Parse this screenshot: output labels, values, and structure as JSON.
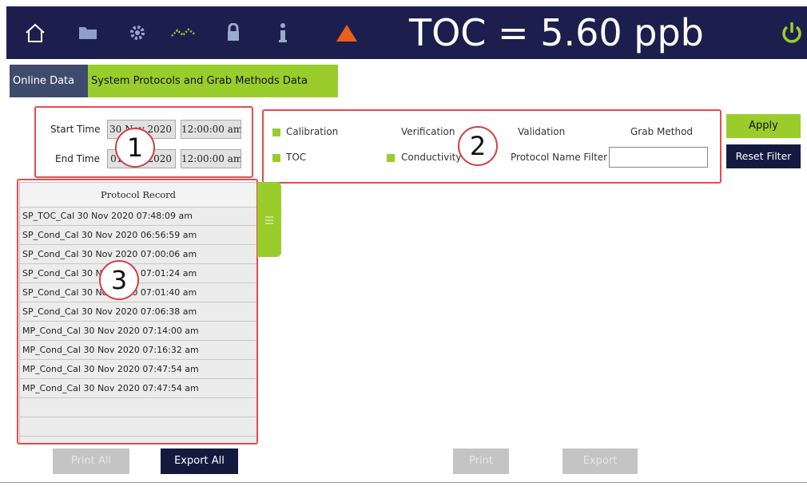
{
  "header": {
    "readout": "TOC = 5.60 ppb",
    "icons": [
      "home-icon",
      "folder-icon",
      "gear-icon",
      "trend-icon",
      "lock-icon",
      "info-icon",
      "warning-icon",
      "power-icon"
    ],
    "colors": {
      "bar": "#1c1f4d",
      "accent": "#9acd2c",
      "alert": "#e8601c"
    }
  },
  "tabs": [
    "Online Data",
    "System Protocols and Grab Methods Data"
  ],
  "time": {
    "start_label": "Start Time",
    "end_label": "End Time",
    "start_date": "30 Nov 2020",
    "start_time": "12:00:00 am",
    "end_date": "01 Dec 2020",
    "end_time": "12:00:00 am"
  },
  "filters": {
    "calibration": "Calibration",
    "verification": "Verification",
    "validation": "Validation",
    "grab_method": "Grab Method",
    "toc": "TOC",
    "conductivity": "Conductivity",
    "name_filter_label": "Protocol Name Filter",
    "name_filter_value": ""
  },
  "buttons": {
    "apply": "Apply",
    "reset": "Reset Filter",
    "print_all": "Print All",
    "export_all": "Export All",
    "print": "Print",
    "export": "Export"
  },
  "protocol_list": {
    "header": "Protocol Record",
    "rows": [
      "SP_TOC_Cal 30 Nov 2020 07:48:09 am",
      "SP_Cond_Cal 30 Nov 2020 06:56:59 am",
      "SP_Cond_Cal 30 Nov 2020 07:00:06 am",
      "SP_Cond_Cal 30 Nov 2020 07:01:24 am",
      "SP_Cond_Cal 30 Nov 2020 07:01:40 am",
      "SP_Cond_Cal 30 Nov 2020 07:06:38 am",
      "MP_Cond_Cal 30 Nov 2020 07:14:00 am",
      "MP_Cond_Cal 30 Nov 2020 07:16:32 am",
      "MP_Cond_Cal 30 Nov 2020 07:47:54 am",
      "MP_Cond_Cal 30 Nov 2020 07:47:54 am",
      "",
      ""
    ]
  },
  "callouts": [
    "1",
    "2",
    "3"
  ]
}
